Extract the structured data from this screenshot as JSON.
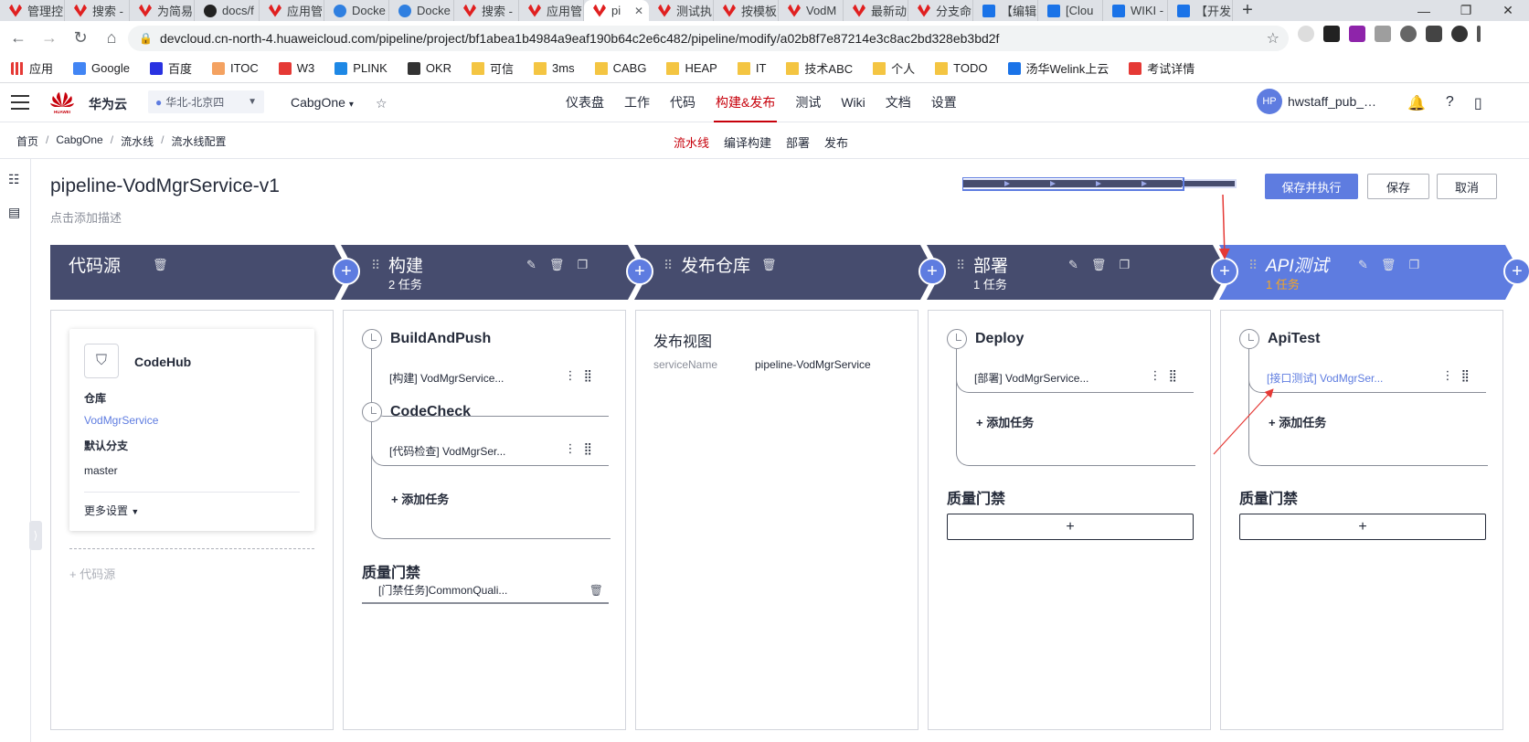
{
  "browser": {
    "tabs": [
      {
        "label": "管理控",
        "icon": "huawei"
      },
      {
        "label": "搜索 -",
        "icon": "huawei"
      },
      {
        "label": "为简易",
        "icon": "huawei"
      },
      {
        "label": "docs/f",
        "icon": "github"
      },
      {
        "label": "应用管",
        "icon": "huawei"
      },
      {
        "label": "Docke",
        "icon": "docker"
      },
      {
        "label": "Docke",
        "icon": "docker"
      },
      {
        "label": "搜索 -",
        "icon": "huawei"
      },
      {
        "label": "应用管",
        "icon": "huawei"
      },
      {
        "label": "pi",
        "icon": "huawei",
        "active": true
      },
      {
        "label": "测试执",
        "icon": "huawei"
      },
      {
        "label": "按模板",
        "icon": "huawei"
      },
      {
        "label": "VodM",
        "icon": "huawei"
      },
      {
        "label": "最新动",
        "icon": "huawei"
      },
      {
        "label": "分支命",
        "icon": "huawei"
      },
      {
        "label": "【编辑",
        "icon": "welink"
      },
      {
        "label": "[Clou",
        "icon": "welink"
      },
      {
        "label": "WIKI -",
        "icon": "welink"
      },
      {
        "label": "【开发",
        "icon": "welink"
      }
    ],
    "url": "devcloud.cn-north-4.huaweicloud.com/pipeline/project/bf1abea1b4984a9eaf190b64c2e6c482/pipeline/modify/a02b8f7e87214e3c8ac2bd328eb3bd2f",
    "bookmarks": [
      "应用",
      "Google",
      "百度",
      "ITOC",
      "W3",
      "PLINK",
      "OKR",
      "可信",
      "3ms",
      "CABG",
      "HEAP",
      "IT",
      "技术ABC",
      "个人",
      "TODO",
      "汤华Welink上云",
      "考试详情"
    ]
  },
  "header": {
    "brand": "华为云",
    "region": "华北-北京四",
    "project": "CabgOne",
    "nav": [
      "仪表盘",
      "工作",
      "代码",
      "构建&发布",
      "测试",
      "Wiki",
      "文档",
      "设置"
    ],
    "active_nav": "构建&发布",
    "avatar_initials": "HP",
    "username": "hwstaff_pub_…"
  },
  "breadcrumb": [
    "首页",
    "CabgOne",
    "流水线",
    "流水线配置"
  ],
  "subtabs": [
    "流水线",
    "编译构建",
    "部署",
    "发布"
  ],
  "active_subtab": "流水线",
  "pipeline": {
    "title": "pipeline-VodMgrService-v1",
    "description_placeholder": "点击添加描述",
    "buttons": {
      "save_run": "保存并执行",
      "save": "保存",
      "cancel": "取消"
    }
  },
  "stages": [
    {
      "name": "代码源",
      "count": ""
    },
    {
      "name": "构建",
      "count": "2 任务"
    },
    {
      "name": "发布仓库",
      "count": ""
    },
    {
      "name": "部署",
      "count": "1 任务"
    },
    {
      "name": "API测试",
      "count": "1 任务"
    }
  ],
  "source": {
    "type": "CodeHub",
    "repo_label": "仓库",
    "repo": "VodMgrService",
    "branch_label": "默认分支",
    "branch": "master",
    "more": "更多设置",
    "add": "+ 代码源"
  },
  "build": {
    "jobs": [
      {
        "name": "BuildAndPush",
        "task": "[构建] VodMgrService..."
      },
      {
        "name": "CodeCheck",
        "task": "[代码检查] VodMgrSer..."
      }
    ],
    "add_task": "添加任务",
    "gate_title": "质量门禁",
    "gate_item": "[门禁任务]CommonQuali..."
  },
  "release": {
    "view_title": "发布视图",
    "key": "serviceName",
    "value": "pipeline-VodMgrService"
  },
  "deploy": {
    "job": "Deploy",
    "task": "[部署] VodMgrService...",
    "add_task": "添加任务",
    "gate_title": "质量门禁",
    "gate_add": "+"
  },
  "apitest": {
    "job": "ApiTest",
    "task": "[接口测试] VodMgrSer...",
    "add_task": "添加任务",
    "gate_title": "质量门禁",
    "gate_add": "+"
  },
  "colors": {
    "brand": "#c7000b",
    "stage": "#464c6e",
    "stage_active": "#5e7ce0",
    "accent": "#5e7ce0",
    "warn": "#f5a623",
    "annotation": "#e53935"
  }
}
